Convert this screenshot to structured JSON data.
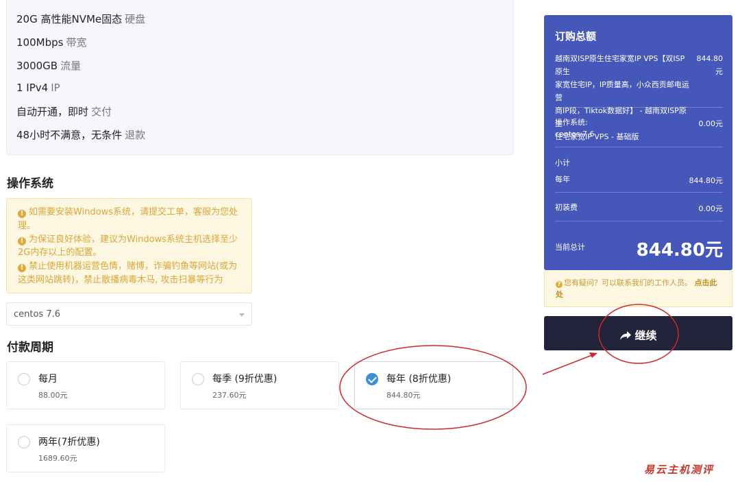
{
  "features": [
    {
      "main": "20G 高性能NVMe固态",
      "dim": "硬盘"
    },
    {
      "main": "100Mbps",
      "dim": "带宽"
    },
    {
      "main": "3000GB",
      "dim": "流量"
    },
    {
      "main": "1 IPv4",
      "dim": "IP"
    },
    {
      "main": "自动开通，即时",
      "dim": "交付"
    },
    {
      "main": "48小时不满意，无条件",
      "dim": "退款"
    }
  ],
  "os_section": {
    "title": "操作系统",
    "warnings": [
      "如需要安装Windows系统，请提交工单，客服为您处理。",
      "为保证良好体验，建议为Windows系统主机选择至少2G内存以上的配置。",
      "禁止使用机器运营色情，赌博，诈骗钓鱼等网站(或为这类网站跳转)，禁止散播病毒木马, 攻击扫暴等行为"
    ],
    "warning_icon": "exclamation-icon",
    "select_value": "centos 7.6"
  },
  "billing": {
    "title": "付款周期",
    "options": [
      {
        "name": "每月",
        "price": "88.00元",
        "selected": false
      },
      {
        "name": "每季 (9折优惠)",
        "price": "237.60元",
        "selected": false
      },
      {
        "name": "每年 (8折优惠)",
        "price": "844.80元",
        "selected": true
      },
      {
        "name": "两年(7折优惠)",
        "price": "1689.60元",
        "selected": false
      }
    ],
    "accent_color": "#3f8fd6"
  },
  "summary": {
    "title": "订购总额",
    "product_lines": [
      "越南双ISP原生住宅家宽IP VPS【双ISP原生",
      "家宽住宅IP，IP质量高，小众西贡邮电运营",
      "商IP段，Tiktok数据好】 - 越南双ISP原生",
      "住宅家宽IP VPS - 基础版"
    ],
    "product_price_lines": [
      "844.80",
      "元"
    ],
    "os_label": "操作系统:",
    "os_value": "centos 7.6",
    "os_price": "0.00元",
    "subtotal_label": "小计",
    "yearly_label": "每年",
    "yearly_price": "844.80元",
    "setup_label": "初装费",
    "setup_price": "0.00元",
    "total_label": "当前总计",
    "total_value": "844.80元",
    "bg_color": "#4557b9"
  },
  "help": {
    "text": "您有疑问？可以联系我们的工作人员。",
    "link": "点击此处"
  },
  "continue_label": "继续",
  "watermark": "易云主机测评"
}
